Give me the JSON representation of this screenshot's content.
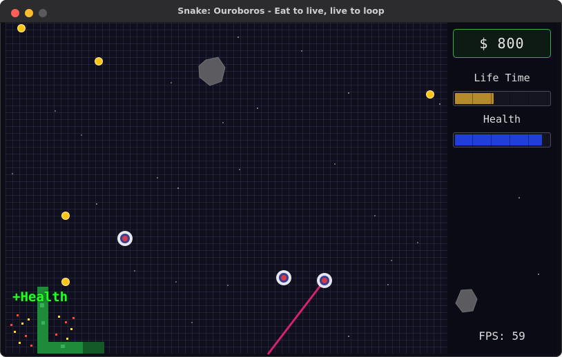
{
  "window": {
    "title": "Snake: Ouroboros - Eat to live, live to loop"
  },
  "hud": {
    "money": "$ 800",
    "life_time_label": "Life Time",
    "life_time_fraction": 0.41,
    "health_label": "Health",
    "health_fraction": 0.93,
    "fps": "FPS: 59"
  },
  "popup": {
    "text": "+Health"
  },
  "colors": {
    "life_time_bar": "#b58a2a",
    "health_bar": "#1f3fd8",
    "snake": "#1f8a3a",
    "laser": "#d4226e",
    "coin": "#ffc61a",
    "money_border": "#3fae4a"
  },
  "icons": {
    "coin": "coin-icon",
    "target": "target-icon",
    "asteroid": "asteroid-icon"
  }
}
